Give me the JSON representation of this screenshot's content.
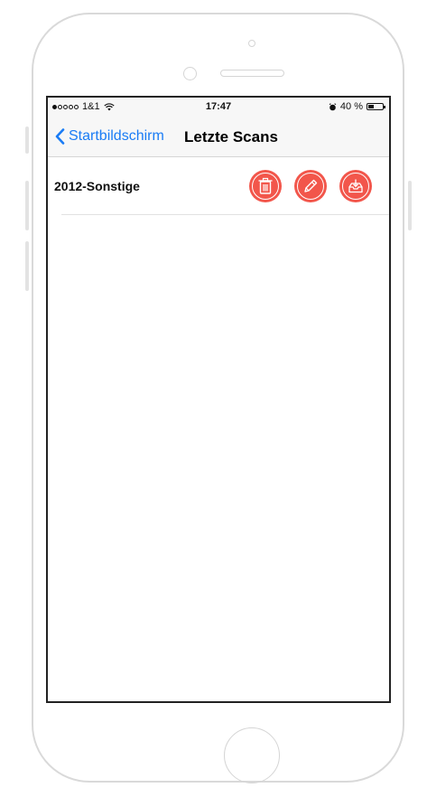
{
  "status_bar": {
    "carrier": "1&1",
    "signal_bars_on": 1,
    "signal_bars_total": 5,
    "time": "17:47",
    "battery": "40 %",
    "battery_level": 0.4,
    "icons": [
      "wifi-icon",
      "alarm-icon",
      "battery-icon"
    ]
  },
  "nav": {
    "back_label": "Startbildschirm",
    "title": "Letzte Scans"
  },
  "list": {
    "items": [
      {
        "label": "2012-Sonstige",
        "actions": [
          "trash-icon",
          "pencil-icon",
          "inbox-download-icon"
        ]
      }
    ]
  },
  "colors": {
    "accent": "#1a7cf5",
    "action": "#f2564b"
  }
}
